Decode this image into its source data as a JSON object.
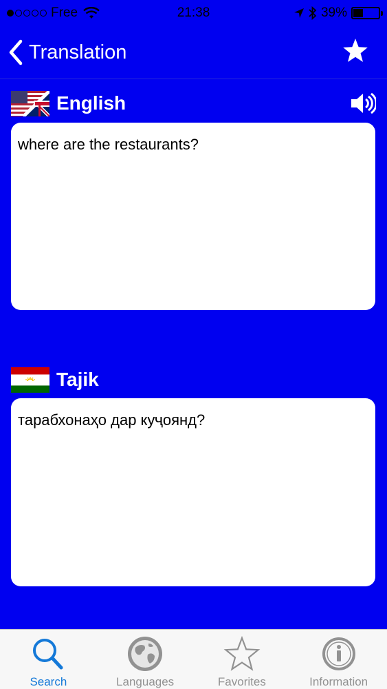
{
  "status_bar": {
    "carrier": "Free",
    "time": "21:38",
    "battery_percent": "39%",
    "battery_level": 0.39,
    "signal_bars": 1,
    "icons": [
      "signal-dots-icon",
      "wifi-icon",
      "location-arrow-icon",
      "bluetooth-icon",
      "battery-icon"
    ]
  },
  "nav": {
    "back_label": "Translation",
    "back_icon": "chevron-left-icon",
    "favorite_icon": "star-icon"
  },
  "source": {
    "language": "English",
    "flag_icon": "us-uk-flag-icon",
    "text": "where are the restaurants?",
    "speaker_icon": "speaker-icon"
  },
  "target": {
    "language": "Tajik",
    "flag_icon": "tajikistan-flag-icon",
    "text": "тарабхонаҳо дар куҷоянд?"
  },
  "tabs": [
    {
      "label": "Search",
      "icon": "search-icon",
      "active": true
    },
    {
      "label": "Languages",
      "icon": "globe-icon",
      "active": false
    },
    {
      "label": "Favorites",
      "icon": "star-outline-icon",
      "active": false
    },
    {
      "label": "Information",
      "icon": "info-icon",
      "active": false
    }
  ],
  "colors": {
    "background": "#0000F0",
    "tab_active": "#1479D8",
    "tab_inactive": "#929292"
  }
}
